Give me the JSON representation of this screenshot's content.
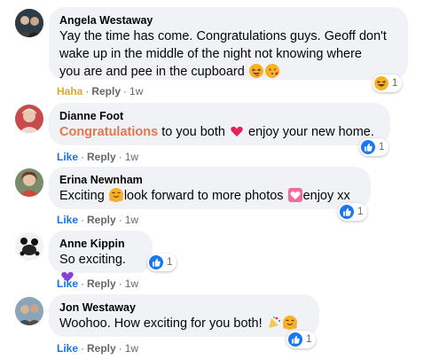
{
  "comments": [
    {
      "name": "Angela Westaway",
      "lines": [
        "Yay the time has come. Congratulations guys. Geoff don't",
        "wake up in the middle of the night not knowing where",
        "you are and pee in the cupboard"
      ],
      "icons": [
        "squinting-tongue-emoji",
        "blowing-kiss-emoji"
      ],
      "actions": {
        "reaction": "Haha",
        "reply": "Reply",
        "time": "1w"
      },
      "reaction": {
        "icon": "haha-reaction-icon",
        "count": "1"
      }
    },
    {
      "name": "Dianne Foot",
      "highlight": "Congratulations",
      "text_after": " to you both ",
      "text_end": " enjoy your new home.",
      "icons": [
        "red-heart-emoji"
      ],
      "actions": {
        "reaction": "Like",
        "reply": "Reply",
        "time": "1w"
      },
      "reaction": {
        "icon": "like-reaction-icon",
        "count": "1"
      }
    },
    {
      "name": "Erina Newnham",
      "text_start": "Exciting ",
      "text_mid": "look forward to more photos ",
      "text_end": "enjoy xx",
      "icons": [
        "hugging-face-emoji",
        "heart-box-emoji"
      ],
      "actions": {
        "reaction": "Like",
        "reply": "Reply",
        "time": "1w"
      },
      "reaction": {
        "icon": "like-reaction-icon",
        "count": "1"
      }
    },
    {
      "name": "Anne Kippin",
      "text_start": "So exciting. ",
      "icons": [
        "purple-heart-emoji"
      ],
      "actions": {
        "reaction": "Like",
        "reply": "Reply",
        "time": "1w"
      },
      "reaction": {
        "icon": "like-reaction-icon",
        "count": "1"
      }
    },
    {
      "name": "Jon Westaway",
      "text_start": "Woohoo. How exciting for you both! ",
      "icons": [
        "party-emoji",
        "hugging-face-emoji"
      ],
      "actions": {
        "reaction": "Like",
        "reply": "Reply",
        "time": "1w"
      },
      "reaction": {
        "icon": "like-reaction-icon",
        "count": "1"
      }
    }
  ],
  "separator": "·",
  "colors": {
    "bubble": "#f0f2f5",
    "like": "#1b74e4",
    "haha": "#e2a62d",
    "highlight": "#e4764f",
    "meta": "#65676b"
  }
}
